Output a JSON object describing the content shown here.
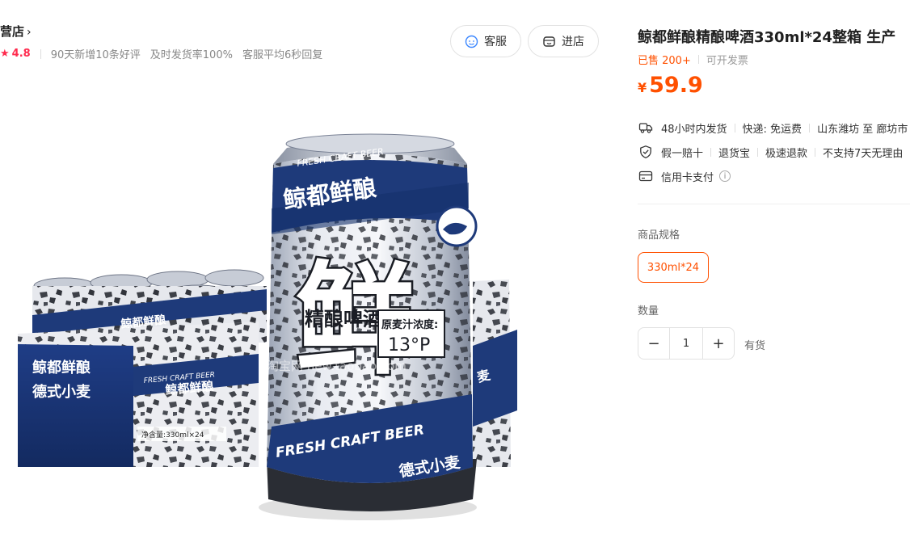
{
  "shop": {
    "name": "营店",
    "chevron": "›",
    "rating": "4.8",
    "stats": [
      "90天新增10条好评",
      "及时发货率100%",
      "客服平均6秒回复"
    ],
    "buttons": {
      "service": "客服",
      "store": "进店"
    }
  },
  "product_image": {
    "box_text": [
      "鲸都鲜酿",
      "德式小麦"
    ],
    "box_label": "FRESH CRAFT BEER",
    "box_net": "净含量:330ml×24",
    "can_top": "FRESH CRAFT BEER",
    "can_brand": "鲸都鲜酿",
    "can_big_char": "鲜",
    "can_sub": "精酿啤酒",
    "can_gravity_label": "原麦汁浓度:",
    "can_gravity_value": "13°P",
    "can_bottom": "FRESH CRAFT BEER",
    "can_wheat": "德式小麦",
    "watermark": "淘宝网 new.taobao.com"
  },
  "product": {
    "title": "鲸都鲜酿精酿啤酒330ml*24整箱 生产",
    "sold": "已售 200+",
    "invoice": "可开发票",
    "currency": "¥",
    "price": "59.9"
  },
  "shipping": [
    "48小时内发货",
    "快递: 免运费",
    "山东潍坊 至 廊坊市"
  ],
  "guarantees": [
    "假一赔十",
    "退货宝",
    "极速退款",
    "不支持7天无理由"
  ],
  "payment": {
    "credit": "信用卡支付",
    "info_icon": "i"
  },
  "spec": {
    "label": "商品规格",
    "options": [
      "330ml*24"
    ]
  },
  "quantity": {
    "label": "数量",
    "minus": "−",
    "plus": "+",
    "value": "1",
    "stock": "有货"
  },
  "colors": {
    "accent": "#ff5000",
    "rating": "#ff2b4e",
    "can_blue": "#1e3a7a"
  }
}
